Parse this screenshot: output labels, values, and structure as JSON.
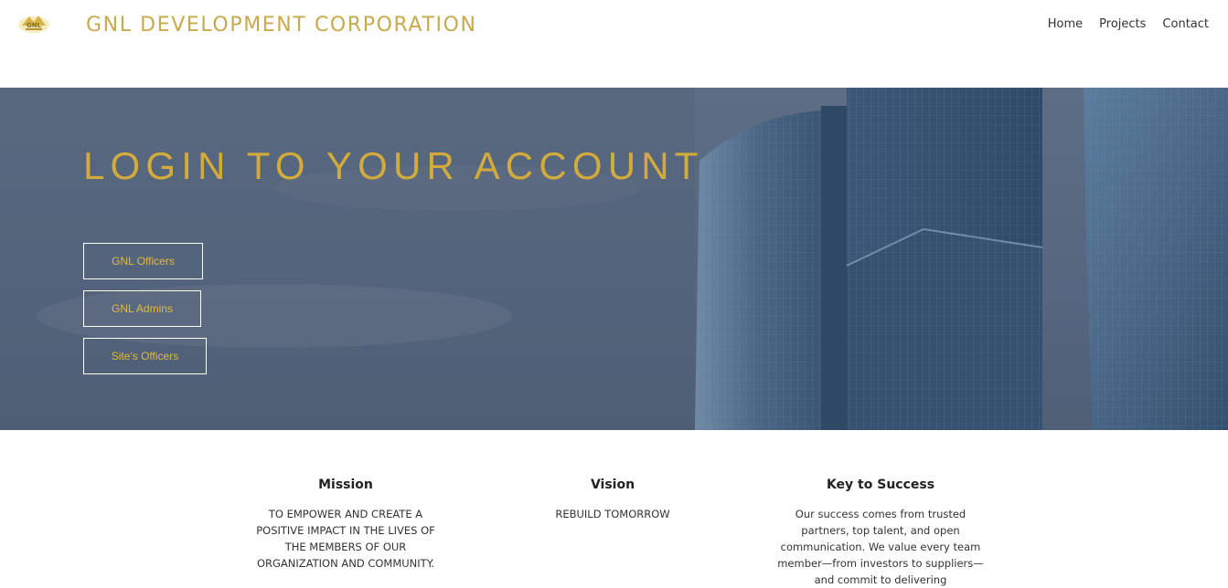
{
  "header": {
    "brand": "GNL DEVELOPMENT CORPORATION",
    "nav": [
      "Home",
      "Projects",
      "Contact"
    ]
  },
  "hero": {
    "title": "LOGIN TO YOUR ACCOUNT",
    "buttons": [
      "GNL Officers",
      "GNL Admins",
      "Site's Officers"
    ]
  },
  "info": {
    "mission": {
      "heading": "Mission",
      "text": "TO EMPOWER AND CREATE A POSITIVE IMPACT IN THE LIVES OF THE MEMBERS OF OUR ORGANIZATION AND COMMUNITY."
    },
    "vision": {
      "heading": "Vision",
      "text": "REBUILD TOMORROW"
    },
    "key": {
      "heading": "Key to Success",
      "text": "Our success comes from trusted partners, top talent, and open communication. We value every team member—from investors to suppliers—and commit to delivering"
    }
  },
  "colors": {
    "gold": "#d3ab3c",
    "brand_gold": "#c9a94e",
    "hero_overlay": "#536279"
  },
  "icons": {
    "logo": "gnl-gold-logo-icon"
  }
}
